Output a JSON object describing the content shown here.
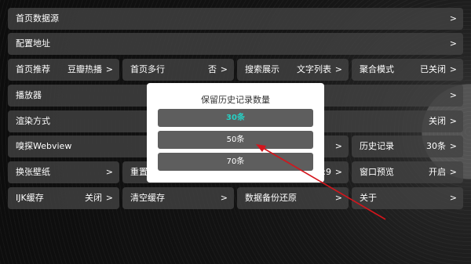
{
  "rows": {
    "home_source": {
      "label": "首页数据源"
    },
    "config_url": {
      "label": "配置地址"
    },
    "home_recommend": {
      "label": "首页推荐",
      "value": "豆瓣热播"
    },
    "home_multiline": {
      "label": "首页多行",
      "value": "否"
    },
    "search_display": {
      "label": "搜索展示",
      "value": "文字列表"
    },
    "aggregate_mode": {
      "label": "聚合模式",
      "value": "已关闭"
    },
    "player": {
      "label": "播放器"
    },
    "render_mode": {
      "label": "渲染方式",
      "value": "关闭"
    },
    "sniff_webview": {
      "label": "嗅探Webview"
    },
    "history": {
      "label": "历史记录",
      "value": "30条"
    },
    "wallpaper": {
      "label": "换张壁纸"
    },
    "reset": {
      "label": "重置",
      "value": "16:9"
    },
    "window_preview": {
      "label": "窗口预览",
      "value": "开启"
    },
    "ijk_cache": {
      "label": "IJK缓存",
      "value": "关闭"
    },
    "clear_cache": {
      "label": "清空缓存"
    },
    "backup_restore": {
      "label": "数据备份还原"
    },
    "about": {
      "label": "关于"
    }
  },
  "chevron": ">",
  "dialog": {
    "title": "保留历史记录数量",
    "options": [
      "30条",
      "50条",
      "70条"
    ],
    "selected": "30条"
  },
  "colors": {
    "selected_text": "#26d1c5",
    "annotation_arrow": "#d4151c"
  }
}
